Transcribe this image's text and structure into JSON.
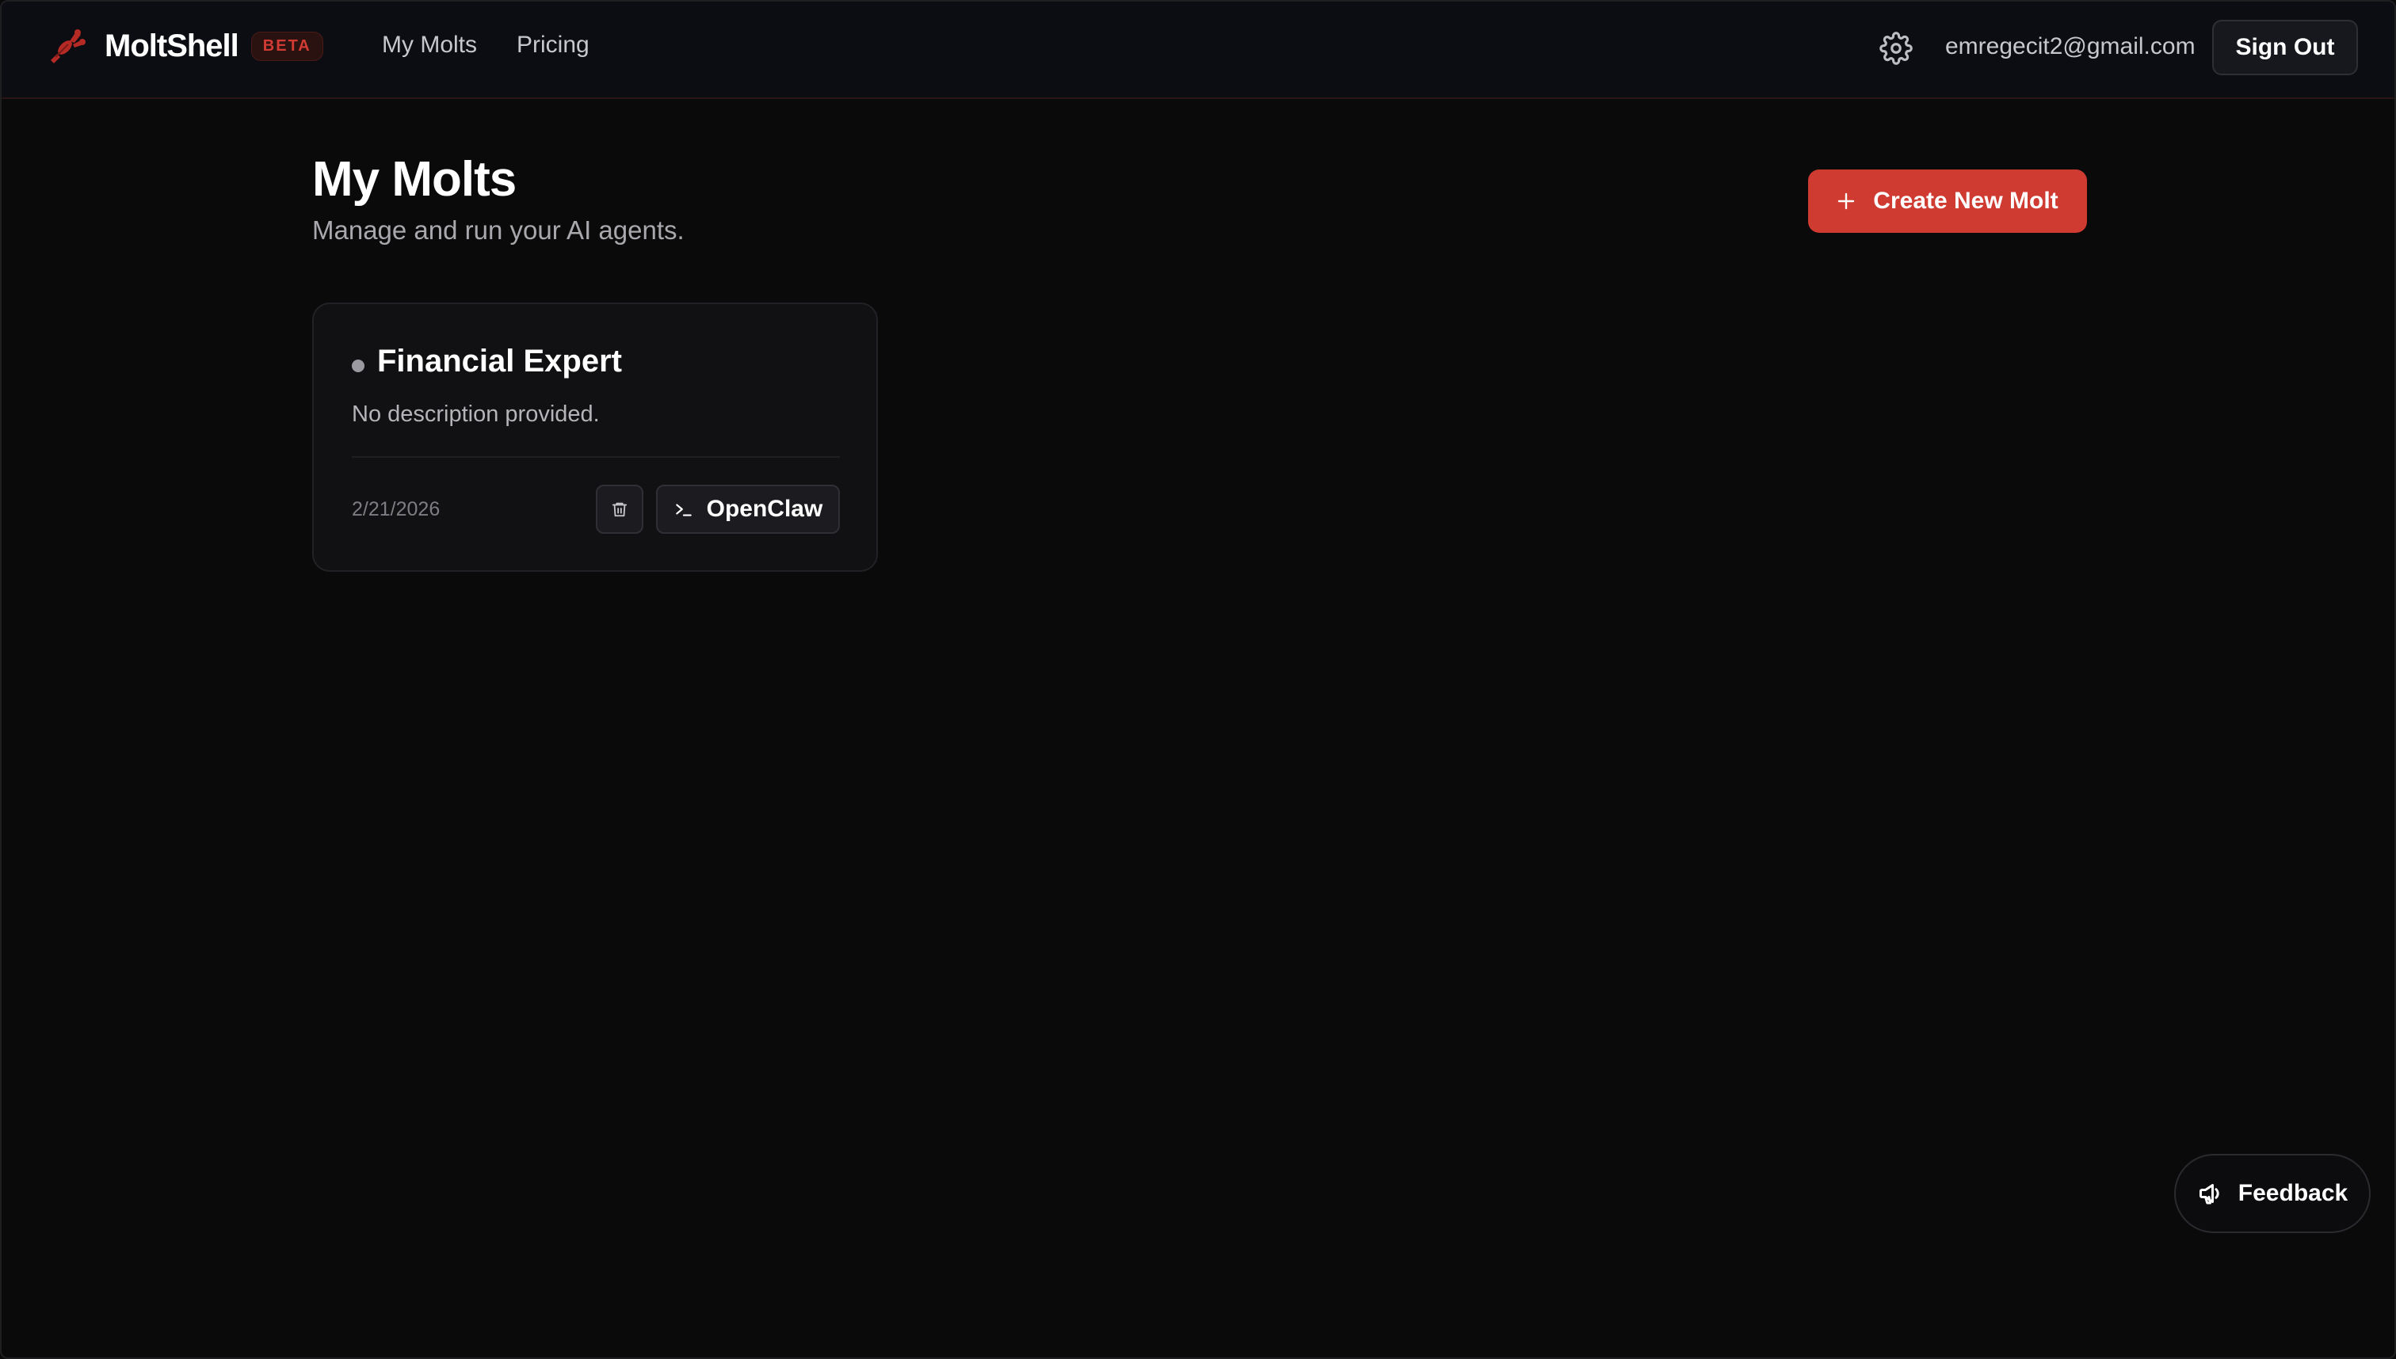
{
  "brand": {
    "name": "MoltShell",
    "badge": "BETA",
    "logo_icon": "lobster-icon"
  },
  "nav": {
    "items": [
      {
        "label": "My Molts"
      },
      {
        "label": "Pricing"
      }
    ]
  },
  "header": {
    "settings_icon": "gear-icon",
    "user_email": "emregecit2@gmail.com",
    "signout_label": "Sign Out"
  },
  "page": {
    "title": "My Molts",
    "subtitle": "Manage and run your AI agents.",
    "create_button_label": "Create New Molt",
    "create_button_icon": "plus-icon"
  },
  "molts": [
    {
      "name": "Financial Expert",
      "description": "No description provided.",
      "date": "2/21/2026",
      "status_color": "#9a9aa0",
      "delete_icon": "trash-icon",
      "action_label": "OpenClaw",
      "action_icon": "terminal-icon"
    }
  ],
  "feedback": {
    "label": "Feedback",
    "icon": "megaphone-icon"
  },
  "colors": {
    "accent": "#cf3a31",
    "background": "#0a0a0b",
    "card": "#111113"
  }
}
